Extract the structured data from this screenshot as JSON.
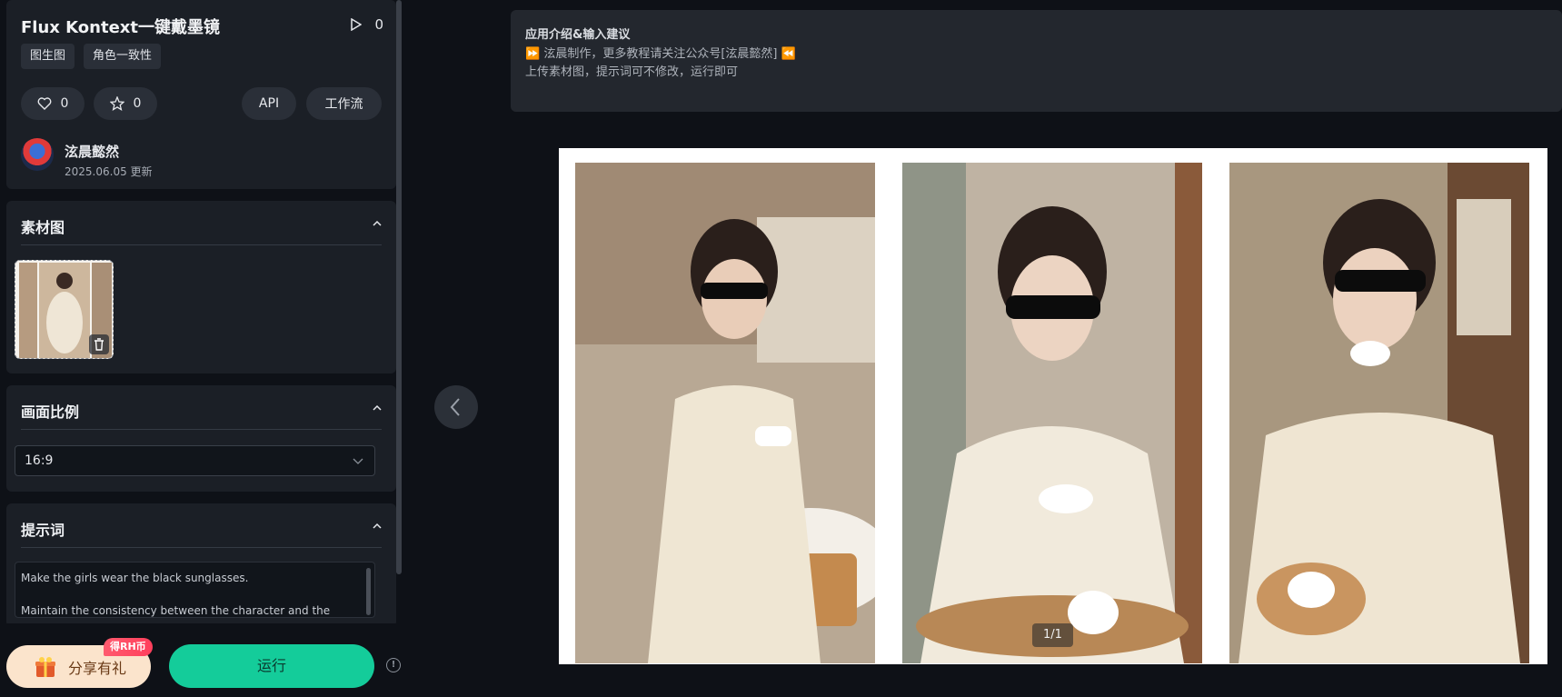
{
  "app": {
    "title": "Flux Kontext一键戴墨镜",
    "run_count": "0",
    "tags": [
      "图生图",
      "角色一致性"
    ],
    "likes": "0",
    "stars": "0",
    "api_label": "API",
    "workflow_label": "工作流",
    "author": "泫晨懿然",
    "updated": "2025.06.05 更新"
  },
  "sections": {
    "material": "素材图",
    "ratio": "画面比例",
    "ratio_value": "16:9",
    "prompt": "提示词"
  },
  "prompt_lines": [
    "Make the girls wear the black sunglasses.",
    "Maintain the consistency between the character and the"
  ],
  "actions": {
    "share": "分享有礼",
    "coin_badge": "得RH币",
    "run": "运行",
    "info": "!"
  },
  "intro": {
    "title": "应用介绍&输入建议",
    "line1": "⏩ 泫晨制作，更多教程请关注公众号[泫晨懿然] ⏪",
    "line2": "上传素材图，提示词可不修改，运行即可"
  },
  "viewer": {
    "counter": "1/1"
  },
  "colors": {
    "run_button": "#14cc9a",
    "share_button": "#fbe4cc",
    "badge": "#ff4a62",
    "panel": "#1b1f26"
  }
}
